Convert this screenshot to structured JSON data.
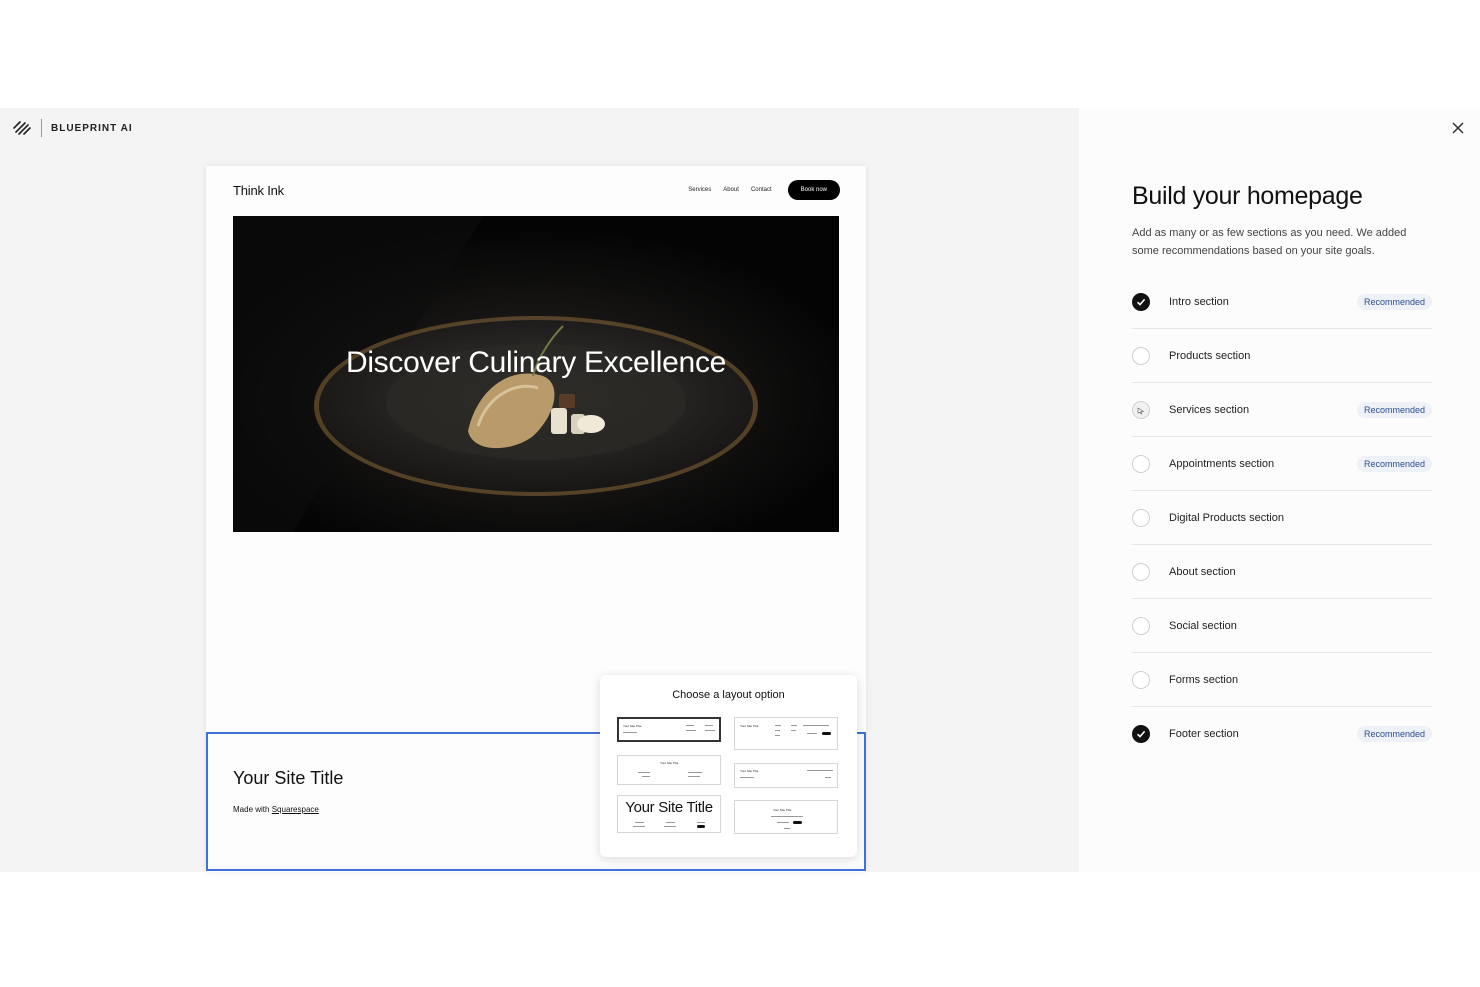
{
  "app": {
    "brand_name": "BLUEPRINT AI"
  },
  "preview": {
    "site_name": "Think Ink",
    "nav": [
      "Services",
      "About",
      "Contact"
    ],
    "cta_label": "Book now",
    "hero_title": "Discover Culinary Excellence",
    "footer_title": "Your Site Title",
    "footer_made_prefix": "Made with",
    "footer_made_link": "Squarespace"
  },
  "layout_popup": {
    "title": "Choose a layout option",
    "thumb_title": "Your Site Title",
    "big_title": "Your Site Title"
  },
  "panel": {
    "title": "Build your homepage",
    "description": "Add as many or as few sections as you need. We added some recommendations based on your site goals.",
    "badge_label": "Recommended",
    "sections": [
      {
        "label": "Intro section",
        "checked": true,
        "recommended": true
      },
      {
        "label": "Products section",
        "checked": false,
        "recommended": false
      },
      {
        "label": "Services section",
        "checked": false,
        "recommended": true
      },
      {
        "label": "Appointments section",
        "checked": false,
        "recommended": true
      },
      {
        "label": "Digital Products section",
        "checked": false,
        "recommended": false
      },
      {
        "label": "About section",
        "checked": false,
        "recommended": false
      },
      {
        "label": "Social section",
        "checked": false,
        "recommended": false
      },
      {
        "label": "Forms section",
        "checked": false,
        "recommended": false
      },
      {
        "label": "Footer section",
        "checked": true,
        "recommended": true
      }
    ]
  },
  "colors": {
    "selection_outline": "#3d73d6",
    "badge_bg": "#eef1f7",
    "badge_text": "#2e4e8e"
  }
}
